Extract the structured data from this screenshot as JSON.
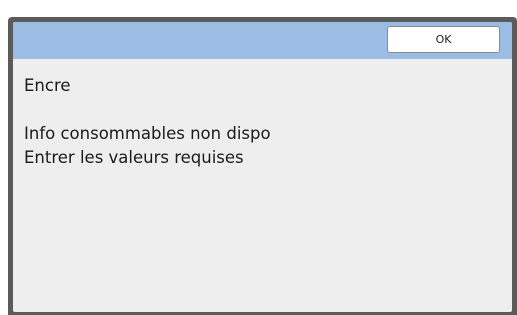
{
  "dialog": {
    "ok_label": "OK",
    "heading": "Encre",
    "messages": [
      "Info consommables non dispo",
      "Entrer les valeurs requises"
    ]
  },
  "colors": {
    "title_bar": "#9cbde3",
    "dialog_bg": "#eeeeee",
    "bezel": "#5b5b5b"
  }
}
